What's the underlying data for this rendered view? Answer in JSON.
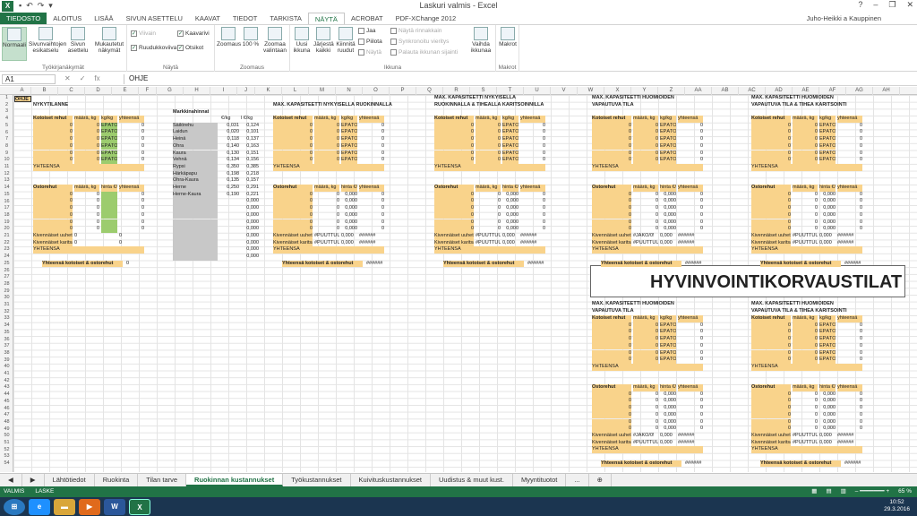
{
  "window": {
    "title": "Laskuri valmis - Excel",
    "user": "Juho-Heikki a Kauppinen"
  },
  "ribbon_tabs": [
    "TIEDOSTO",
    "ALOITUS",
    "LISÄÄ",
    "SIVUN ASETTELU",
    "KAAVAT",
    "TIEDOT",
    "TARKISTA",
    "NÄYTÄ",
    "ACROBAT",
    "PDF-XChange 2012"
  ],
  "ribbon": {
    "views": {
      "normal": "Normaali",
      "pagebreak": "Sivunvaihtojen esikatselu",
      "pagelayout": "Sivun asettelu",
      "custom": "Mukautetut näkymät",
      "label": "Työkirjanäkymät"
    },
    "show": {
      "ruler": "Viivain",
      "gridlines": "Ruudukkoviiva",
      "formulabar": "Kaavarivi",
      "headings": "Otsikot",
      "label": "Näytä"
    },
    "zoom": {
      "zoom": "Zoomaus",
      "hundred": "100 %",
      "selection": "Zoomaa valintaan",
      "label": "Zoomaus"
    },
    "window": {
      "new": "Uusi ikkuna",
      "arrange": "Järjestä kaikki",
      "freeze": "Kiinnitä ruudut",
      "split": "Jaa",
      "hide": "Piilota",
      "unhide": "Näytä",
      "side": "Näytä rinnakkain",
      "sync": "Synkronoitu vieritys",
      "reset": "Palauta ikkunan sijainti",
      "switch": "Vaihda ikkunaa",
      "label": "Ikkuna"
    },
    "macros": {
      "macros": "Makrot",
      "label": "Makrot"
    }
  },
  "formula": {
    "namebox": "A1",
    "fx": "fx",
    "content": "OHJE"
  },
  "columns": [
    "A",
    "B",
    "C",
    "D",
    "E",
    "F",
    "G",
    "H",
    "I",
    "J",
    "K",
    "L",
    "M",
    "N",
    "O",
    "P",
    "Q",
    "R",
    "S",
    "T",
    "U",
    "V",
    "W",
    "X",
    "Y",
    "Z",
    "AA",
    "AB",
    "AC",
    "AD",
    "AE",
    "AF",
    "AG",
    "AH"
  ],
  "sheet": {
    "ohje": "OHJE",
    "nykytilanne": "NYKYTILANNE",
    "markkinahinnat": "Markkinahinnat",
    "hdr_kotoiset": "Kotoiset rehut",
    "hdr_ostorehut": "Ostorehut",
    "hdr_maara": "määrä, kg",
    "hdr_kg": "kg/kg",
    "hdr_hinta": "hinta €/kg",
    "hdr_yht": "yhteensä",
    "hdr_ekg": "€/kg",
    "hdr_lkg": "l €/kg",
    "yhteensa": "YHTEENSÄ",
    "kivennais_uuhet": "Kivennäiset uuhet",
    "kivennais_karitsat": "Kivennäiset karitsa",
    "yht_kotoiset_osto": "Yhteensä kotoiset & ostorehut",
    "epatosi": "EPÄTOSI",
    "puuttuu": "#PUUTTUU!",
    "jakoo": "#JAKO/0!",
    "hashes": "######",
    "t1": "MAX. KAPASITEETTI NYKYISELLÄ RUOKINNALLA",
    "t2a": "MAX. KAPASITEETTI NYKYISELLÄ",
    "t2b": "RUOKINNALLA & TIHEÄLLÄ KARITSOINNILLA",
    "t3a": "MAX. KAPASITEETTI HUOMIOIDEN",
    "t3b": "VAPAUTUVA TILA",
    "t4a": "MAX. KAPASITEETTI HUOMIOIDEN",
    "t4b": "VAPAUTUVA TILA & TIHEÄ KARITSOINTI",
    "big": "HYVINVOINTIKORVAUSTILAT",
    "market": [
      {
        "name": "Säilörehu",
        "a": "0,031",
        "b": "0,124"
      },
      {
        "name": "Laidun",
        "a": "0,020",
        "b": "0,101"
      },
      {
        "name": "Heinä",
        "a": "0,118",
        "b": "0,137"
      },
      {
        "name": "Ohra",
        "a": "0,140",
        "b": "0,163"
      },
      {
        "name": "Kaura",
        "a": "0,130",
        "b": "0,151"
      },
      {
        "name": "Vehnä",
        "a": "0,134",
        "b": "0,156"
      },
      {
        "name": "Rypsi",
        "a": "0,350",
        "b": "0,385"
      },
      {
        "name": "Härkäpapu",
        "a": "0,198",
        "b": "0,218"
      },
      {
        "name": "Ohra-Kaura",
        "a": "0,135",
        "b": "0,157"
      },
      {
        "name": "Herne",
        "a": "0,250",
        "b": "0,291"
      },
      {
        "name": "Herne-Kaura",
        "a": "0,190",
        "b": "0,221"
      }
    ],
    "zero": "0",
    "zero3": "0,000"
  },
  "sheet_tabs": [
    "Lähtötiedot",
    "Ruokinta",
    "Tilan tarve",
    "Ruokinnan kustannukset",
    "Työkustannukset",
    "Kuivituskustannukset",
    "Uudistus & muut kust.",
    "Myyntituotot",
    "..."
  ],
  "status": {
    "left": "VALMIS",
    "mode": "LASKE",
    "zoom": "65 %"
  },
  "clock": {
    "time": "10:52",
    "date": "29.3.2016"
  }
}
